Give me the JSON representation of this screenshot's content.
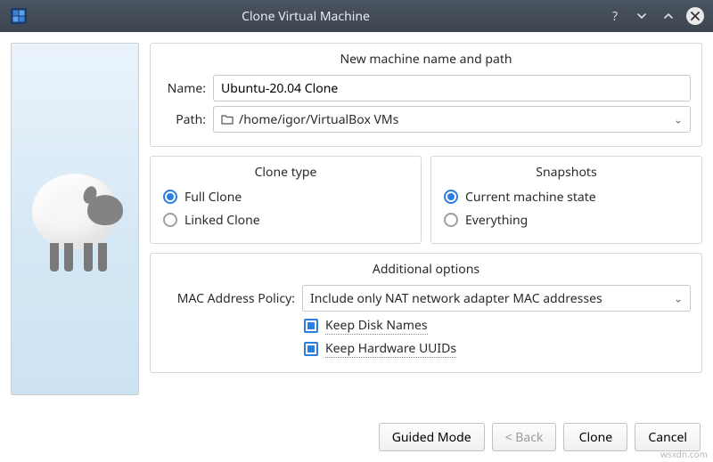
{
  "window": {
    "title": "Clone Virtual Machine"
  },
  "group_name_path": {
    "title": "New machine name and path",
    "name_label": "Name:",
    "name_value": "Ubuntu-20.04 Clone",
    "path_label": "Path:",
    "path_value": "/home/igor/VirtualBox VMs"
  },
  "clone_type": {
    "title": "Clone type",
    "full": "Full Clone",
    "linked": "Linked Clone",
    "selected": "full"
  },
  "snapshots": {
    "title": "Snapshots",
    "current": "Current machine state",
    "everything": "Everything",
    "selected": "current"
  },
  "additional": {
    "title": "Additional options",
    "mac_policy_label": "MAC Address Policy:",
    "mac_policy_value": "Include only NAT network adapter MAC addresses",
    "keep_disk_names": "Keep Disk Names",
    "keep_hw_uuids": "Keep Hardware UUIDs"
  },
  "buttons": {
    "guided": "Guided Mode",
    "back": "< Back",
    "clone": "Clone",
    "cancel": "Cancel"
  },
  "watermark": "wsxdn.com"
}
